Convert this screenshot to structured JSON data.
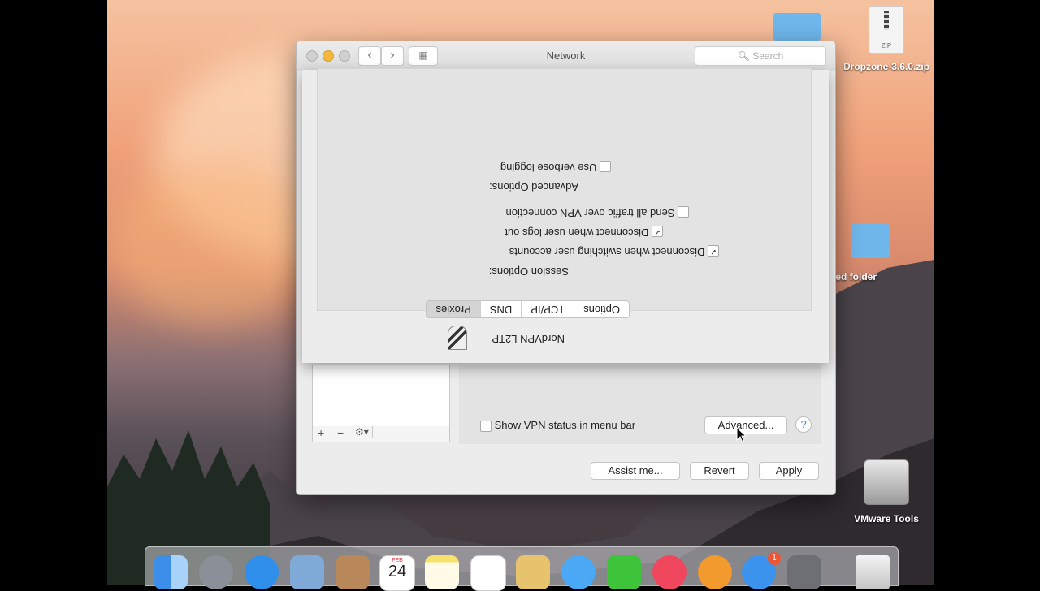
{
  "window": {
    "title": "Network",
    "search_placeholder": "Search"
  },
  "desktop": {
    "zip_icon_badge": "ZIP",
    "zip_file_name": "Dropzone-3.6.0.zip",
    "folder_name": "led folder",
    "vmware_tools": "VMware Tools"
  },
  "main": {
    "show_vpn_status_label": "Show VPN status in menu bar",
    "show_vpn_status_checked": false,
    "advanced_button": "Advanced...",
    "help_button": "?",
    "assist_button": "Assist me...",
    "revert_button": "Revert",
    "apply_button": "Apply",
    "list_add": "+",
    "list_remove": "−",
    "list_gear": "⚙▾"
  },
  "sheet": {
    "service_name": "NordVPN L2TP",
    "tabs": [
      {
        "label": "Options",
        "active": true
      },
      {
        "label": "TCP/IP",
        "active": false
      },
      {
        "label": "DNS",
        "active": false
      },
      {
        "label": "Proxies",
        "active": false
      }
    ],
    "session_options_label": "Session Options:",
    "session_options": [
      {
        "label": "Disconnect when switching user accounts",
        "checked": true
      },
      {
        "label": "Disconnect when user logs out",
        "checked": true
      },
      {
        "label": "Send all traffic over VPN connection",
        "checked": false
      }
    ],
    "advanced_options_label": "Advanced Options:",
    "advanced_options": [
      {
        "label": "Use verbose logging",
        "checked": false
      }
    ]
  },
  "dock": {
    "calendar_month": "FEB",
    "calendar_day": "24",
    "app_store_badge": "1"
  }
}
